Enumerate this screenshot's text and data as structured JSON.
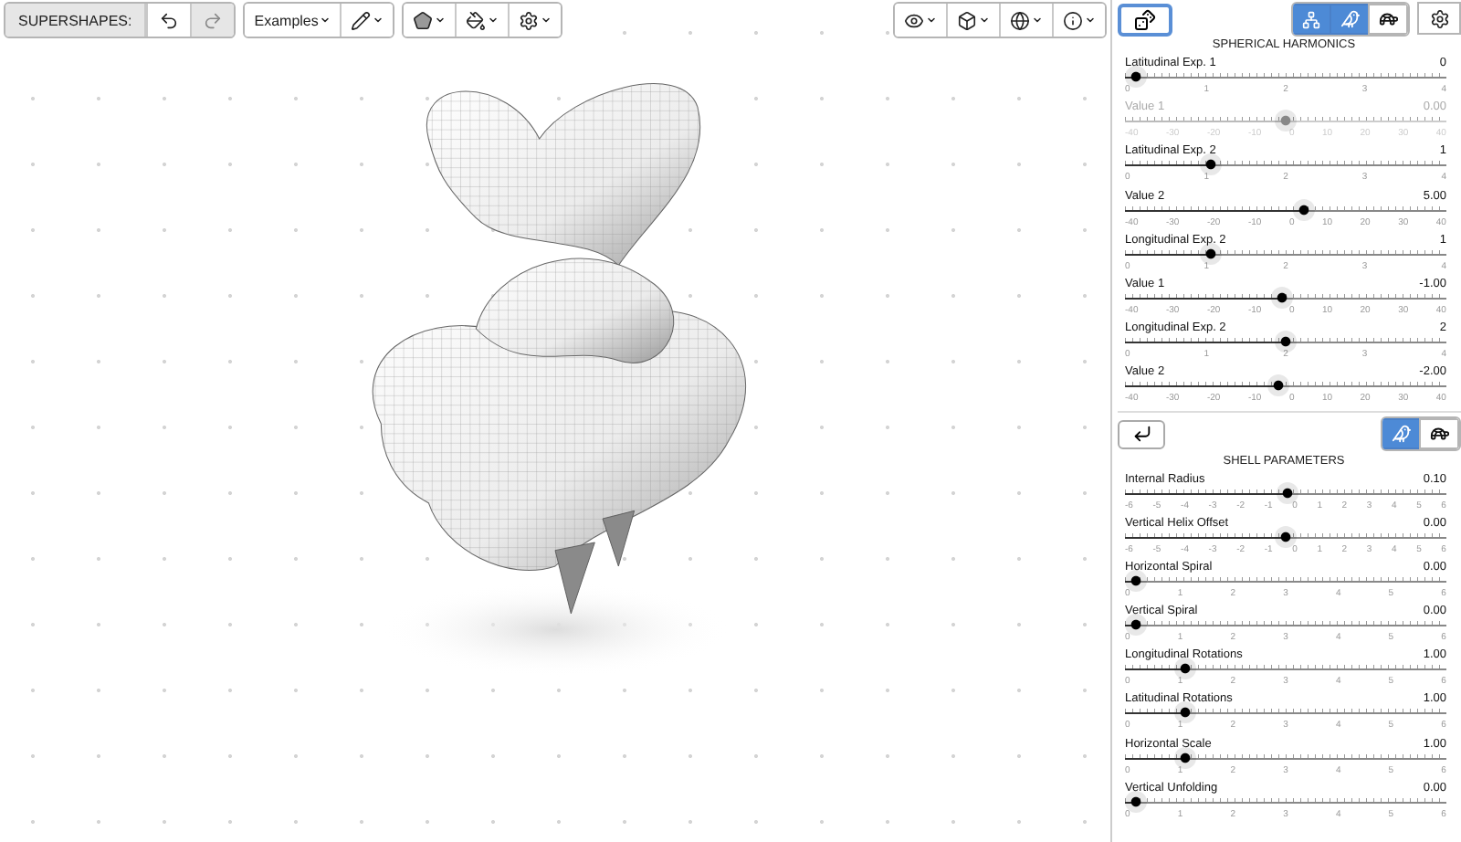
{
  "toolbar": {
    "title": "SUPERSHAPES:",
    "examples_label": "Examples"
  },
  "mode_buttons": [
    {
      "kind": "network",
      "selected": true
    },
    {
      "kind": "bird",
      "selected": true
    },
    {
      "kind": "turtle",
      "selected": false
    }
  ],
  "spherical_harmonics": {
    "title": "SPHERICAL HARMONICS",
    "sliders": [
      {
        "label": "Latitudinal Exp. 1",
        "value": "0",
        "level": 0,
        "disabled": false,
        "ticks": [
          "0",
          "1",
          "2",
          "3",
          "4"
        ]
      },
      {
        "label": "Value 1",
        "value": "0.00",
        "level": 0.5,
        "disabled": true,
        "ticks": [
          "-40",
          "-30",
          "-20",
          "-10",
          "0",
          "10",
          "20",
          "30",
          "40"
        ]
      },
      {
        "label": "Latitudinal Exp. 2",
        "value": "1",
        "level": 0.25,
        "disabled": false,
        "ticks": [
          "0",
          "1",
          "2",
          "3",
          "4"
        ]
      },
      {
        "label": "Value 2",
        "value": "5.00",
        "level": 0.5625,
        "disabled": false,
        "ticks": [
          "-40",
          "-30",
          "-20",
          "-10",
          "0",
          "10",
          "20",
          "30",
          "40"
        ]
      },
      {
        "label": "Longitudinal Exp. 2",
        "value": "1",
        "level": 0.25,
        "disabled": false,
        "ticks": [
          "0",
          "1",
          "2",
          "3",
          "4"
        ]
      },
      {
        "label": "Value 1",
        "value": "-1.00",
        "level": 0.4875,
        "disabled": false,
        "ticks": [
          "-40",
          "-30",
          "-20",
          "-10",
          "0",
          "10",
          "20",
          "30",
          "40"
        ]
      },
      {
        "label": "Longitudinal Exp. 2",
        "value": "2",
        "level": 0.5,
        "disabled": false,
        "ticks": [
          "0",
          "1",
          "2",
          "3",
          "4"
        ]
      },
      {
        "label": "Value 2",
        "value": "-2.00",
        "level": 0.475,
        "disabled": false,
        "ticks": [
          "-40",
          "-30",
          "-20",
          "-10",
          "0",
          "10",
          "20",
          "30",
          "40"
        ]
      }
    ]
  },
  "shell_mode_buttons": [
    {
      "kind": "bird",
      "selected": true
    },
    {
      "kind": "turtle",
      "selected": false
    }
  ],
  "shell_parameters": {
    "title": "SHELL PARAMETERS",
    "sliders": [
      {
        "label": "Internal Radius",
        "value": "0.10",
        "level": 0.508,
        "disabled": false,
        "ticks": [
          "-6",
          "-5",
          "-4",
          "-3",
          "-2",
          "-1",
          "0",
          "1",
          "2",
          "3",
          "4",
          "5",
          "6"
        ]
      },
      {
        "label": "Vertical Helix Offset",
        "value": "0.00",
        "level": 0.5,
        "disabled": false,
        "ticks": [
          "-6",
          "-5",
          "-4",
          "-3",
          "-2",
          "-1",
          "0",
          "1",
          "2",
          "3",
          "4",
          "5",
          "6"
        ]
      },
      {
        "label": "Horizontal Spiral",
        "value": "0.00",
        "level": 0,
        "disabled": false,
        "ticks": [
          "0",
          "1",
          "2",
          "3",
          "4",
          "5",
          "6"
        ]
      },
      {
        "label": "Vertical Spiral",
        "value": "0.00",
        "level": 0,
        "disabled": false,
        "ticks": [
          "0",
          "1",
          "2",
          "3",
          "4",
          "5",
          "6"
        ]
      },
      {
        "label": "Longitudinal Rotations",
        "value": "1.00",
        "level": 0.1667,
        "disabled": false,
        "ticks": [
          "0",
          "1",
          "2",
          "3",
          "4",
          "5",
          "6"
        ]
      },
      {
        "label": "Latitudinal Rotations",
        "value": "1.00",
        "level": 0.1667,
        "disabled": false,
        "ticks": [
          "0",
          "1",
          "2",
          "3",
          "4",
          "5",
          "6"
        ]
      },
      {
        "label": "Horizontal Scale",
        "value": "1.00",
        "level": 0.1667,
        "disabled": false,
        "ticks": [
          "0",
          "1",
          "2",
          "3",
          "4",
          "5",
          "6"
        ]
      },
      {
        "label": "Vertical Unfolding",
        "value": "0.00",
        "level": 0,
        "disabled": false,
        "ticks": [
          "0",
          "1",
          "2",
          "3",
          "4",
          "5",
          "6"
        ]
      }
    ]
  }
}
